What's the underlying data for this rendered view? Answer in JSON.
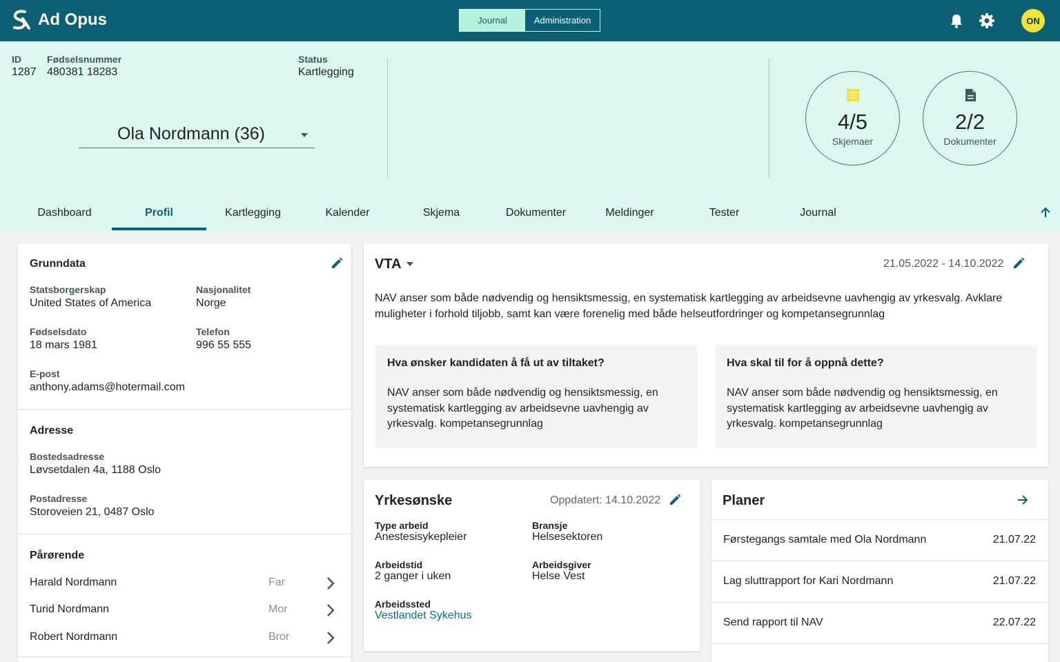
{
  "app": {
    "title": "Ad Opus"
  },
  "switcher": {
    "journal": "Journal",
    "admin": "Administration"
  },
  "user": {
    "initials": "ON"
  },
  "header": {
    "id_label": "ID",
    "id_value": "1287",
    "fnr_label": "Fødselsnummer",
    "fnr_value": "480381 18283",
    "status_label": "Status",
    "status_value": "Kartlegging",
    "person": "Ola Nordmann (36)",
    "forms": {
      "count": "4/5",
      "label": "Skjemaer"
    },
    "docs": {
      "count": "2/2",
      "label": "Dokumenter"
    }
  },
  "tabs": [
    "Dashboard",
    "Profil",
    "Kartlegging",
    "Kalender",
    "Skjema",
    "Dokumenter",
    "Meldinger",
    "Tester",
    "Journal"
  ],
  "grunndata": {
    "title": "Grunndata",
    "statsborgerskap_label": "Statsborgerskap",
    "statsborgerskap": "United States of America",
    "nasjonalitet_label": "Nasjonalitet",
    "nasjonalitet": "Norge",
    "fodselsdato_label": "Fødselsdato",
    "fodselsdato": "18 mars 1981",
    "telefon_label": "Telefon",
    "telefon": "996 55 555",
    "epost_label": "E-post",
    "epost": "anthony.adams@hotermail.com"
  },
  "adresse": {
    "title": "Adresse",
    "bosted_label": "Bostedsadresse",
    "bosted": "Løvsetdalen 4a, 1188 Oslo",
    "post_label": "Postadresse",
    "post": "Storoveien 21, 0487 Oslo"
  },
  "parorende": {
    "title": "Pårørende",
    "items": [
      {
        "name": "Harald Nordmann",
        "relation": "Far"
      },
      {
        "name": "Turid Nordmann",
        "relation": "Mor"
      },
      {
        "name": "Robert Nordmann",
        "relation": "Bror"
      }
    ]
  },
  "vta": {
    "title": "VTA",
    "period": "21.05.2022 - 14.10.2022",
    "description": "NAV anser som både nødvendig og hensiktsmessig, en systematisk kartlegging av arbeidsevne uavhengig av yrkesvalg. Avklare muligheter i forhold tiljobb, samt kan være forenelig med  både helseutfordringer og kompetansegrunnlag",
    "q1": "Hva ønsker kandidaten å få ut av tiltaket?",
    "a1": "NAV anser som både nødvendig og hensiktsmessig, en systematisk kartlegging av arbeidsevne uavhengig av yrkesvalg. kompetansegrunnlag",
    "q2": "Hva skal til for å oppnå dette?",
    "a2": "NAV anser som både nødvendig og hensiktsmessig, en systematisk kartlegging av arbeidsevne uavhengig av yrkesvalg. kompetansegrunnlag"
  },
  "yrke": {
    "title": "Yrkesønske",
    "updated": "Oppdatert: 14.10.2022",
    "type_label": "Type arbeid",
    "type": "Anestesisykepleier",
    "bransje_label": "Bransje",
    "bransje": "Helsesektoren",
    "tid_label": "Arbeidstid",
    "tid": "2 ganger i uken",
    "giver_label": "Arbeidsgiver",
    "giver": "Helse Vest",
    "sted_label": "Arbeidssted",
    "sted": "Vestlandet Sykehus"
  },
  "planer": {
    "title": "Planer",
    "items": [
      {
        "text": "Førstegangs samtale  med Ola Nordmann",
        "date": "21.07.22"
      },
      {
        "text": "Lag sluttrapport for Kari Nordmann",
        "date": "21.07.22"
      },
      {
        "text": "Send rapport til NAV",
        "date": "22.07.22"
      }
    ]
  },
  "colors": {
    "brand": "#0d5f73",
    "hero_bg": "#dcf7ef",
    "switch_active": "#b6f1de",
    "avatar": "#f1e33b",
    "link": "#0d6b84"
  },
  "icons": [
    "logo-icon",
    "bell-icon",
    "gear-icon",
    "chevron-down-icon",
    "form-list-icon",
    "document-icon",
    "arrow-up-icon",
    "pencil-icon",
    "chevron-right-icon",
    "arrow-right-icon"
  ]
}
